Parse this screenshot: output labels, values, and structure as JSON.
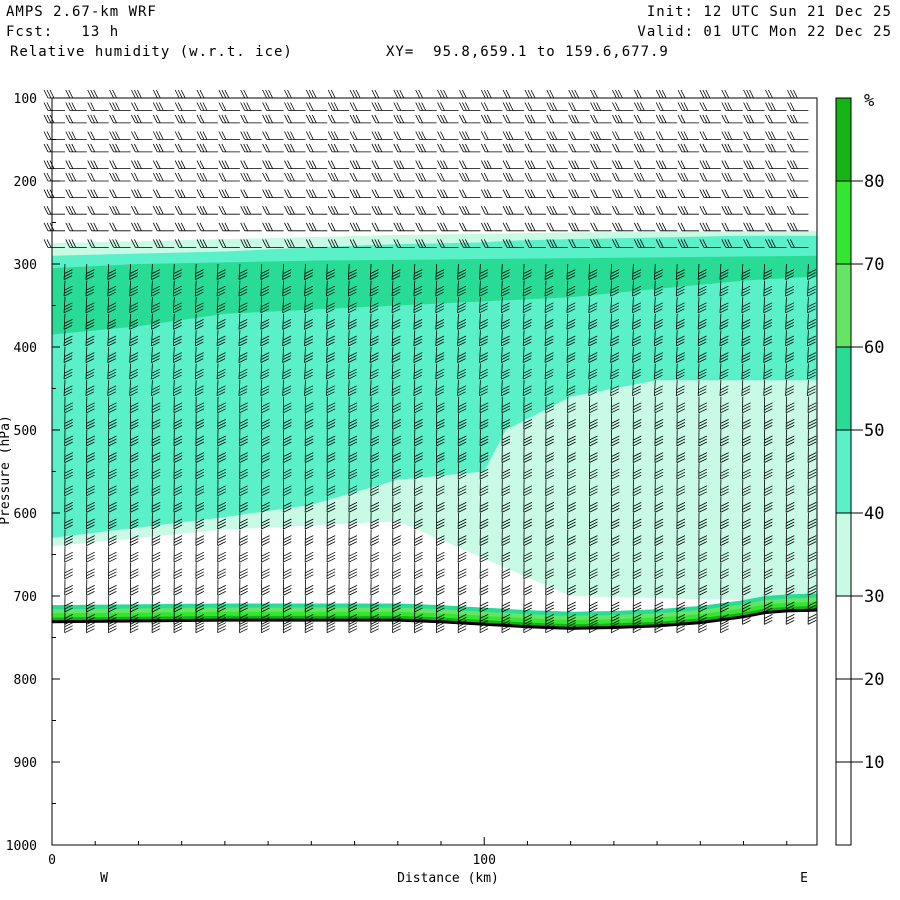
{
  "header": {
    "model": "AMPS 2.67-km WRF",
    "fcst": "Fcst:   13 h",
    "field": "Relative humidity (w.r.t. ice)",
    "xy": "XY=  95.8,659.1 to 159.6,677.9",
    "init": "Init: 12 UTC Sun 21 Dec 25",
    "valid": "Valid: 01 UTC Mon 22 Dec 25"
  },
  "chart_data": {
    "type": "area",
    "title": "Relative humidity (w.r.t. ice)",
    "xlabel": "Distance (km)",
    "ylabel": "Pressure (hPa)",
    "xlim": [
      0,
      177
    ],
    "ylim": [
      1000,
      100
    ],
    "x_ticks": [
      0,
      100
    ],
    "y_ticks": [
      100,
      200,
      300,
      400,
      500,
      600,
      700,
      800,
      900,
      1000
    ],
    "x_end_labels": {
      "left": "W",
      "right": "E"
    },
    "colorbar": {
      "unit": "%",
      "levels": [
        0,
        10,
        20,
        30,
        40,
        50,
        60,
        70,
        80,
        90
      ],
      "tick_labels": [
        10,
        20,
        30,
        40,
        50,
        60,
        70,
        80
      ],
      "colors": [
        "#ffffff",
        "#ffffff",
        "#ffffff",
        "#c8fae6",
        "#5af0c8",
        "#28dc96",
        "#64e664",
        "#32e632",
        "#14b414"
      ]
    },
    "terrain_pressure": {
      "x": [
        0,
        20,
        40,
        60,
        80,
        90,
        100,
        110,
        120,
        130,
        140,
        150,
        160,
        165,
        170,
        177
      ],
      "p": [
        731,
        730,
        729,
        729,
        729,
        731,
        734,
        737,
        739,
        738,
        736,
        732,
        725,
        720,
        718,
        717
      ]
    },
    "rh_layers": [
      {
        "level": 30,
        "x": [
          0,
          40,
          80,
          120,
          160,
          177
        ],
        "bottom": [
          640,
          620,
          610,
          700,
          705,
          705
        ],
        "top": [
          275,
          270,
          265,
          262,
          260,
          260
        ]
      },
      {
        "level": 40,
        "x": [
          0,
          40,
          60,
          80,
          100,
          105,
          120,
          140,
          160,
          177
        ],
        "bottom": [
          630,
          605,
          590,
          560,
          550,
          500,
          460,
          440,
          440,
          440
        ],
        "top": [
          290,
          285,
          280,
          276,
          274,
          272,
          270,
          268,
          266,
          266
        ]
      },
      {
        "level": 50,
        "x": [
          0,
          20,
          40,
          60,
          80,
          100,
          120,
          140,
          160,
          177
        ],
        "bottom": [
          385,
          375,
          360,
          355,
          350,
          345,
          340,
          330,
          320,
          315
        ],
        "top": [
          305,
          300,
          298,
          296,
          295,
          294,
          293,
          292,
          291,
          290
        ]
      }
    ],
    "surface_moist_band": {
      "levels": [
        50,
        60,
        70,
        80
      ],
      "depth_hpa": 20
    },
    "wind_barbs": {
      "columns": 35,
      "x_start_km": 3,
      "x_end_km": 175,
      "levels_hpa": [
        100,
        115,
        130,
        150,
        165,
        185,
        200,
        220,
        240,
        260,
        280,
        300,
        320,
        340,
        360,
        380,
        400,
        420,
        440,
        460,
        480,
        500,
        520,
        540,
        560,
        580,
        600,
        620,
        640,
        660,
        680,
        700,
        715,
        725
      ]
    }
  }
}
